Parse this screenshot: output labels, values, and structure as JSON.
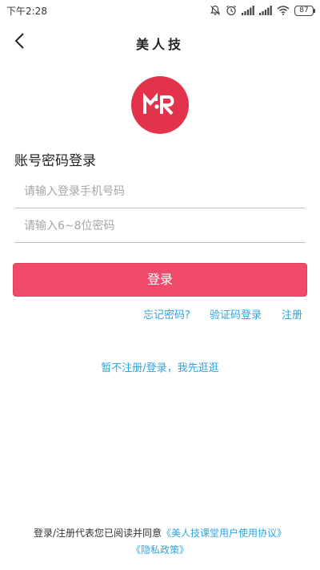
{
  "status_bar": {
    "time": "下午2:28",
    "battery": "87",
    "icons": [
      "mute-icon",
      "alarm-icon",
      "signal-icon",
      "signal-icon",
      "wifi-icon",
      "battery-icon"
    ]
  },
  "header": {
    "title": "美人技",
    "back_icon": "chevron-left-icon"
  },
  "logo": {
    "color": "#e3334c",
    "icon": "app-logo-icon"
  },
  "login": {
    "heading": "账号密码登录",
    "phone_placeholder": "请输入登录手机号码",
    "phone_value": "",
    "password_placeholder": "请输入6~8位密码",
    "password_value": "",
    "button_label": "登录",
    "button_color": "#f04a6b"
  },
  "links": {
    "forgot": "忘记密码?",
    "sms_login": "验证码登录",
    "register": "注册",
    "skip": "暂不注册/登录，我先逛逛",
    "color": "#2fa4e0"
  },
  "agreement": {
    "prefix": "登录/注册代表您已阅读并同意",
    "user_agreement": "《美人技课堂用户使用协议》",
    "privacy_policy": "《隐私政策》"
  }
}
